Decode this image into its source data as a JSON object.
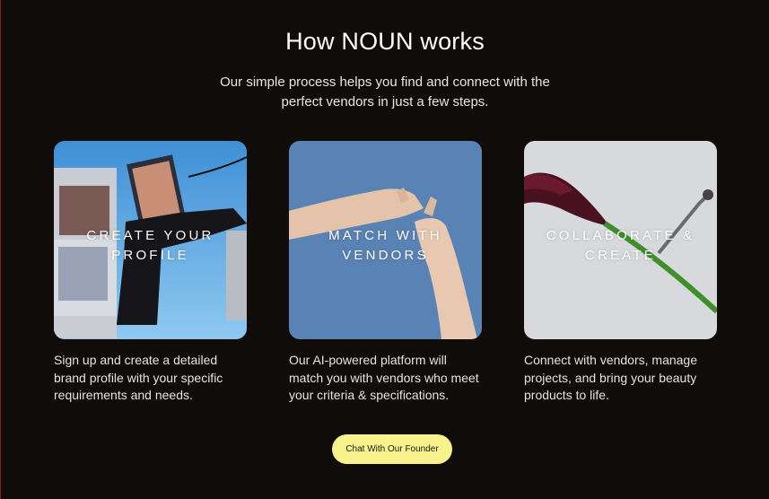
{
  "section": {
    "title": "How NOUN works",
    "subtitle": "Our simple process helps you find and connect with the perfect vendors in just a few steps."
  },
  "steps": [
    {
      "label": "CREATE YOUR PROFILE",
      "description": "Sign up and create a detailed brand profile with your specific requirements and needs."
    },
    {
      "label": "MATCH WITH VENDORS",
      "description": "Our AI-powered platform will match you with vendors who meet your criteria & specifications."
    },
    {
      "label": "COLLABORATE & CREATE",
      "description": "Connect with vendors, manage projects, and bring your beauty products to life."
    }
  ],
  "cta": {
    "label": "Chat With Our Founder"
  },
  "colors": {
    "background": "#0f0c0a",
    "cta_background": "#f7f28c"
  }
}
